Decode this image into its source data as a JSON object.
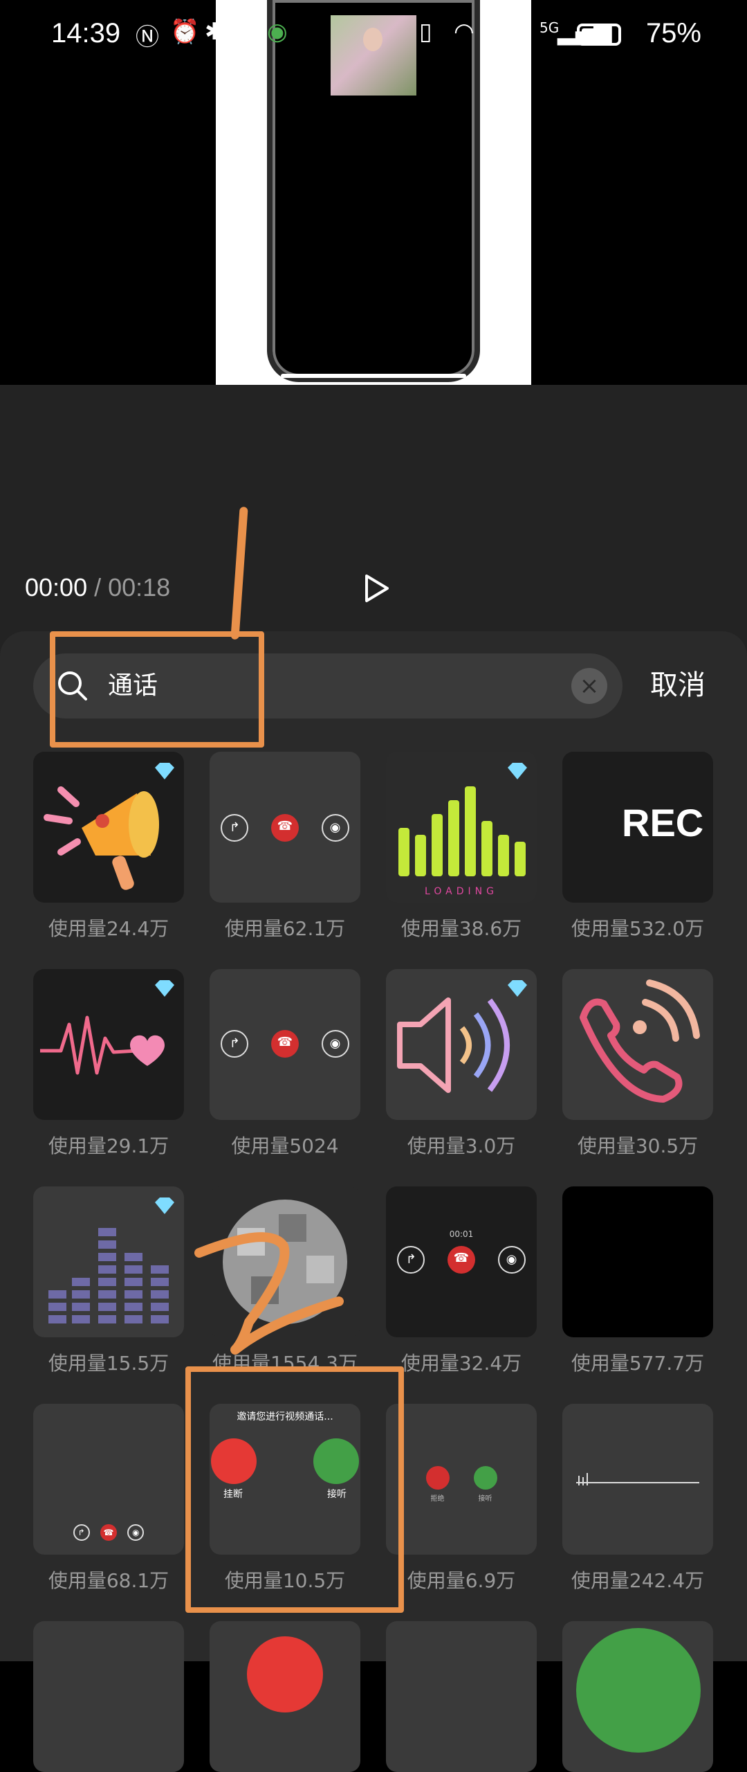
{
  "status_bar": {
    "time": "14:39",
    "signal_label": "5G",
    "battery_percent": "75%",
    "battery_level": 0.75
  },
  "player": {
    "current_time": "00:00",
    "separator": " / ",
    "total_time": "00:18"
  },
  "search": {
    "query": "通话",
    "cancel_label": "取消"
  },
  "grid": [
    {
      "usage": "使用量24.4万",
      "premium": true
    },
    {
      "usage": "使用量62.1万",
      "premium": false
    },
    {
      "usage": "使用量38.6万",
      "premium": true
    },
    {
      "usage": "使用量532.0万",
      "premium": false,
      "label": "REC"
    },
    {
      "usage": "使用量29.1万",
      "premium": true
    },
    {
      "usage": "使用量5024",
      "premium": false
    },
    {
      "usage": "使用量3.0万",
      "premium": true
    },
    {
      "usage": "使用量30.5万",
      "premium": false
    },
    {
      "usage": "使用量15.5万",
      "premium": true
    },
    {
      "usage": "使用量1554.3万",
      "premium": false
    },
    {
      "usage": "使用量32.4万",
      "premium": false,
      "timer": "00:01"
    },
    {
      "usage": "使用量577.7万",
      "premium": false
    },
    {
      "usage": "使用量68.1万",
      "premium": false
    },
    {
      "usage": "使用量10.5万",
      "premium": false,
      "title": "邀请您进行视频通话...",
      "decline_label": "挂断",
      "accept_label": "接听"
    },
    {
      "usage": "使用量6.9万",
      "premium": false,
      "decline_label": "拒绝",
      "accept_label": "接听"
    },
    {
      "usage": "使用量242.4万",
      "premium": false
    }
  ],
  "colors": {
    "annotation": "#e9914b",
    "panel": "#2a2a2a",
    "tile": "#3a3a3a"
  }
}
